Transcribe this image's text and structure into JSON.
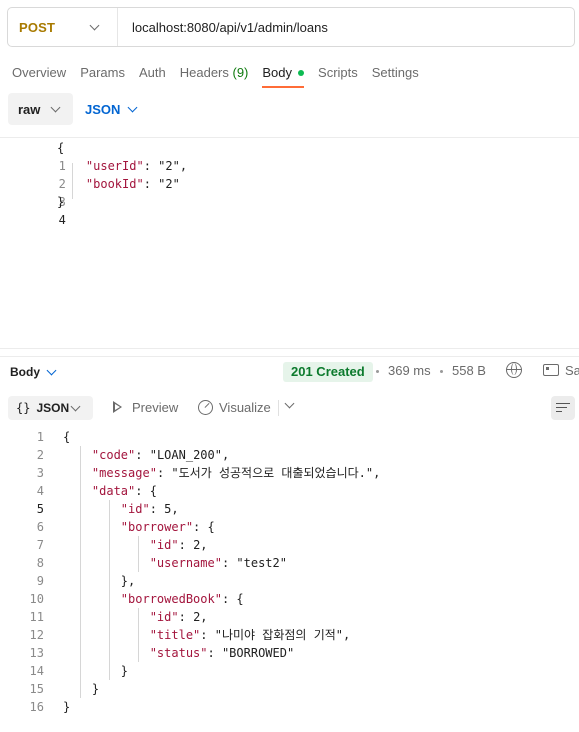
{
  "request": {
    "method": "POST",
    "url": "localhost:8080/api/v1/admin/loans",
    "tabs": [
      {
        "label": "Overview"
      },
      {
        "label": "Params"
      },
      {
        "label": "Auth"
      },
      {
        "label": "Headers",
        "count": "(9)"
      },
      {
        "label": "Body",
        "active": true,
        "indicator": true
      },
      {
        "label": "Scripts"
      },
      {
        "label": "Settings"
      }
    ],
    "body_mode": "raw",
    "body_language": "JSON",
    "body_lines": [
      {
        "n": "1",
        "text": "{"
      },
      {
        "n": "2",
        "text": "    \"userId\": \"2\","
      },
      {
        "n": "3",
        "text": "    \"bookId\": \"2\""
      },
      {
        "n": "4",
        "text": "}"
      }
    ]
  },
  "response": {
    "section_label": "Body",
    "status": "201 Created",
    "time": "369 ms",
    "size": "558 B",
    "save_label": "Sa",
    "format": "JSON",
    "preview_label": "Preview",
    "visualize_label": "Visualize",
    "body_lines": [
      {
        "n": "1",
        "text": "{"
      },
      {
        "n": "2",
        "text": "    \"code\": \"LOAN_200\","
      },
      {
        "n": "3",
        "text": "    \"message\": \"도서가 성공적으로 대출되었습니다.\","
      },
      {
        "n": "4",
        "text": "    \"data\": {"
      },
      {
        "n": "5",
        "text": "        \"id\": 5,"
      },
      {
        "n": "6",
        "text": "        \"borrower\": {"
      },
      {
        "n": "7",
        "text": "            \"id\": 2,"
      },
      {
        "n": "8",
        "text": "            \"username\": \"test2\""
      },
      {
        "n": "9",
        "text": "        },"
      },
      {
        "n": "10",
        "text": "        \"borrowedBook\": {"
      },
      {
        "n": "11",
        "text": "            \"id\": 2,"
      },
      {
        "n": "12",
        "text": "            \"title\": \"나미야 잡화점의 기적\","
      },
      {
        "n": "13",
        "text": "            \"status\": \"BORROWED\""
      },
      {
        "n": "14",
        "text": "        }"
      },
      {
        "n": "15",
        "text": "    }"
      },
      {
        "n": "16",
        "text": "}"
      }
    ]
  },
  "colors": {
    "method": "#a87a00",
    "accent": "#ff6c37",
    "status_success": "#0c7a2d",
    "json_key": "#a3153d",
    "json_string": "#1a3eb8",
    "json_number": "#0f7b0f",
    "link_blue": "#0265d2"
  },
  "icons": [
    "chevron-down-icon",
    "body-dot-icon",
    "globe-icon",
    "save-response-icon",
    "braces-icon",
    "preview-play-icon",
    "visualize-icon",
    "wrap-lines-icon"
  ]
}
